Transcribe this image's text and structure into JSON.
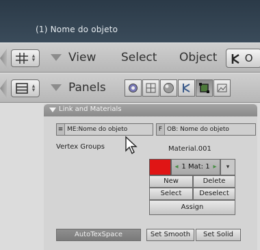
{
  "viewport": {
    "title": "(1) Nome do objeto"
  },
  "header_3d": {
    "menus": [
      "View",
      "Select",
      "Object"
    ],
    "mode_label": "O"
  },
  "header_buttons": {
    "panels_label": "Panels"
  },
  "panel": {
    "title": "Link and Materials",
    "me_field": "ME:Nome do objeto",
    "me_prefix": "≡",
    "f_prefix": "F",
    "ob_field": "OB: Nome do objeto",
    "vertex_groups_label": "Vertex Groups",
    "material_name": "Material.001",
    "mat_counter": "1 Mat: 1",
    "buttons": {
      "new": "New",
      "delete": "Delete",
      "select": "Select",
      "deselect": "Deselect",
      "assign": "Assign"
    },
    "autotexspace": "AutoTexSpace",
    "set_smooth": "Set Smooth",
    "set_solid": "Set Solid"
  },
  "colors": {
    "material_color": "#e01515"
  }
}
